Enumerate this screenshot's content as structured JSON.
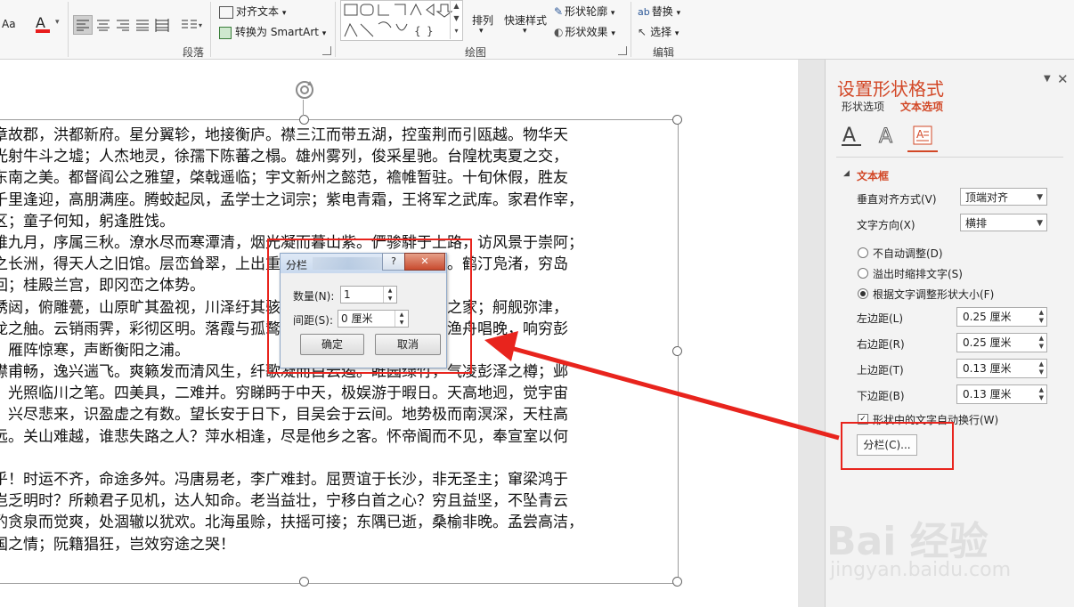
{
  "ribbon": {
    "font_size_btn": "Aa",
    "font_color_btn": "A",
    "align_text": "对齐文本",
    "convert_smartart": "转换为 SmartArt",
    "arrange": "排列",
    "quick_styles": "快速样式",
    "shape_outline": "形状轮廓",
    "shape_effects": "形状效果",
    "replace": "替换",
    "select": "选择",
    "groups": {
      "paragraph": "段落",
      "drawing": "绘图",
      "editing": "编辑"
    }
  },
  "slide": {
    "lines": [
      "章故郡，洪都新府。星分翼轸，地接衡庐。襟三江而带五湖，控蛮荆而引瓯越。物华天",
      "光射牛斗之墟；人杰地灵，徐孺下陈蕃之榻。雄州雾列，俊采星驰。台隍枕夷夏之交，",
      "东南之美。都督阎公之雅望，棨戟遥临；宇文新州之懿范，襜帷暂驻。十旬休假，胜友",
      "千里逢迎，高朋满座。腾蛟起凤，孟学士之词宗；紫电青霜，王将军之武库。家君作宰，",
      "区；童子何知，躬逢胜饯。",
      "维九月，序属三秋。潦水尽而寒潭清，烟光凝而暮山紫。俨骖騑于上路，访风景于崇阿；",
      "之长洲，得天人之旧馆。层峦耸翠，上出重霄；飞阁流丹，下临无地。鹤汀凫渚，穷岛",
      "回；桂殿兰宫，即冈峦之体势。",
      "绣闼，俯雕甍，山原旷其盈视，川泽纡其骇瞩。闾阎扑地，钟鸣鼎食之家；舸舰弥津，",
      "龙之舳。云销雨霁，彩彻区明。落霞与孤鹜齐飞，秋水共长天一色。渔舟唱晚，响穷彭",
      "，雁阵惊寒，声断衡阳之浦。",
      "襟甫畅，逸兴遄飞。爽籁发而清风生，纤歌凝而白云遏。睢园绿竹，气凌彭泽之樽；邺",
      "，光照临川之笔。四美具，二难并。穷睇眄于中天，极娱游于暇日。天高地迥，觉宇宙",
      "，兴尽悲来，识盈虚之有数。望长安于日下，目吴会于云间。地势极而南溟深，天柱高",
      "远。关山难越，谁悲失路之人？萍水相逢，尽是他乡之客。怀帝阍而不见，奉宣室以何",
      "",
      "乎！时运不齐，命途多舛。冯唐易老，李广难封。屈贾谊于长沙，非无圣主；窜梁鸿于",
      "岂乏明时？所赖君子见机，达人知命。老当益壮，宁移白首之心？穷且益坚，不坠青云",
      "酌贪泉而觉爽，处涸辙以犹欢。北海虽赊，扶摇可接；东隅已逝，桑榆非晚。孟尝高洁，",
      "国之情；阮籍猖狂，岂效穷途之哭！"
    ]
  },
  "dialog": {
    "title": "分栏",
    "help": "?",
    "close": "✕",
    "count_label": "数量(N):",
    "count_value": "1",
    "spacing_label": "间距(S):",
    "spacing_value": "0 厘米",
    "ok": "确定",
    "cancel": "取消"
  },
  "pane": {
    "title": "设置形状格式",
    "tab_shape": "形状选项",
    "tab_text": "文本选项",
    "section": "文本框",
    "valign_label": "垂直对齐方式(V)",
    "valign_value": "顶端对齐",
    "direction_label": "文字方向(X)",
    "direction_value": "横排",
    "radio_noautofit": "不自动调整(D)",
    "radio_shrink": "溢出时缩排文字(S)",
    "radio_resize": "根据文字调整形状大小(F)",
    "left_margin_label": "左边距(L)",
    "left_margin_value": "0.25 厘米",
    "right_margin_label": "右边距(R)",
    "right_margin_value": "0.25 厘米",
    "top_margin_label": "上边距(T)",
    "top_margin_value": "0.13 厘米",
    "bottom_margin_label": "下边距(B)",
    "bottom_margin_value": "0.13 厘米",
    "wrap_label": "形状中的文字自动换行(W)",
    "columns_button": "分栏(C)..."
  },
  "watermark": {
    "brand": "Bai 经验",
    "url": "jingyan.baidu.com"
  },
  "colors": {
    "accent": "#d24726",
    "highlight": "#e8241d"
  }
}
